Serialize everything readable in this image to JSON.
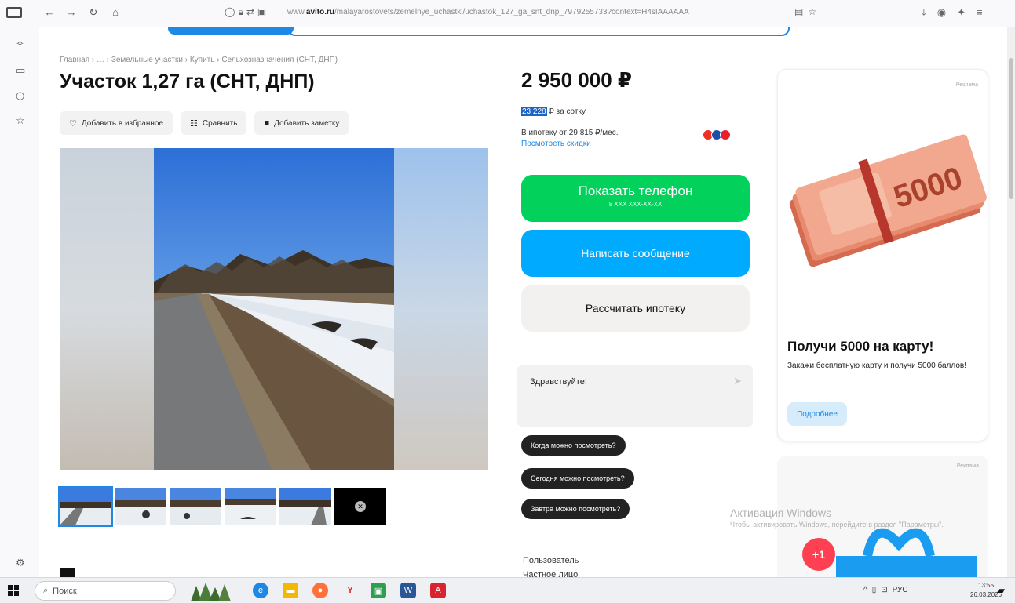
{
  "browser": {
    "url_prefix": "www.",
    "url_domain": "avito.ru",
    "url_path": "/malayarostovets/zemelnye_uchastki/uchastok_127_ga_snt_dnp_7979255733?context=H4sIAAAAAA"
  },
  "breadcrumb": "Главная › … › Земельные участки › Купить › Сельхозназначения (СНТ, ДНП)",
  "listing": {
    "title": "Участок 1,27 га (СНТ, ДНП)",
    "actions": [
      {
        "label": "Добавить в избранное",
        "icon": "heart-icon"
      },
      {
        "label": "Сравнить",
        "icon": "compare-icon"
      },
      {
        "label": "Добавить заметку",
        "icon": "note-icon"
      }
    ]
  },
  "price": {
    "value": "2 950 000 ₽",
    "per_unit_highlight": "23 228",
    "per_unit_suffix": " ₽ за сотку",
    "mortgage": "В ипотеку от 29 815 ₽/мес.",
    "discounts_link": "Посмотреть скидки"
  },
  "buttons": {
    "phone_label": "Показать телефон",
    "phone_number": "8 XXX XXX-XX-XX",
    "message_label": "Написать сообщение",
    "calc_label": "Рассчитать ипотеку"
  },
  "message": {
    "placeholder": "Здравствуйте!",
    "quick_replies": [
      "Когда можно посмотреть?",
      "Сегодня можно посмотреть?",
      "Завтра можно посмотреть?"
    ]
  },
  "seller": {
    "label": "Пользователь",
    "type": "Частное лицо"
  },
  "ad": {
    "label": "Реклама",
    "title": "Получи 5000 на карту!",
    "description": "Закажи бесплатную карту и получи 5000 баллов!",
    "button": "Подробнее",
    "banknote_text": "5000"
  },
  "ad2": {
    "label": "Реклама",
    "badge": "+1"
  },
  "windows_activation": {
    "title": "Активация Windows",
    "subtitle": "Чтобы активировать Windows, перейдите в раздел \"Параметры\"."
  },
  "taskbar": {
    "search_placeholder": "Поиск",
    "language": "РУС",
    "time": "13:55",
    "date": "26.03.2026"
  },
  "colors": {
    "green": "#02d15c",
    "blue": "#00aaff",
    "link": "#1e88e5",
    "chip": "#222222",
    "badge": "#ff4053"
  }
}
